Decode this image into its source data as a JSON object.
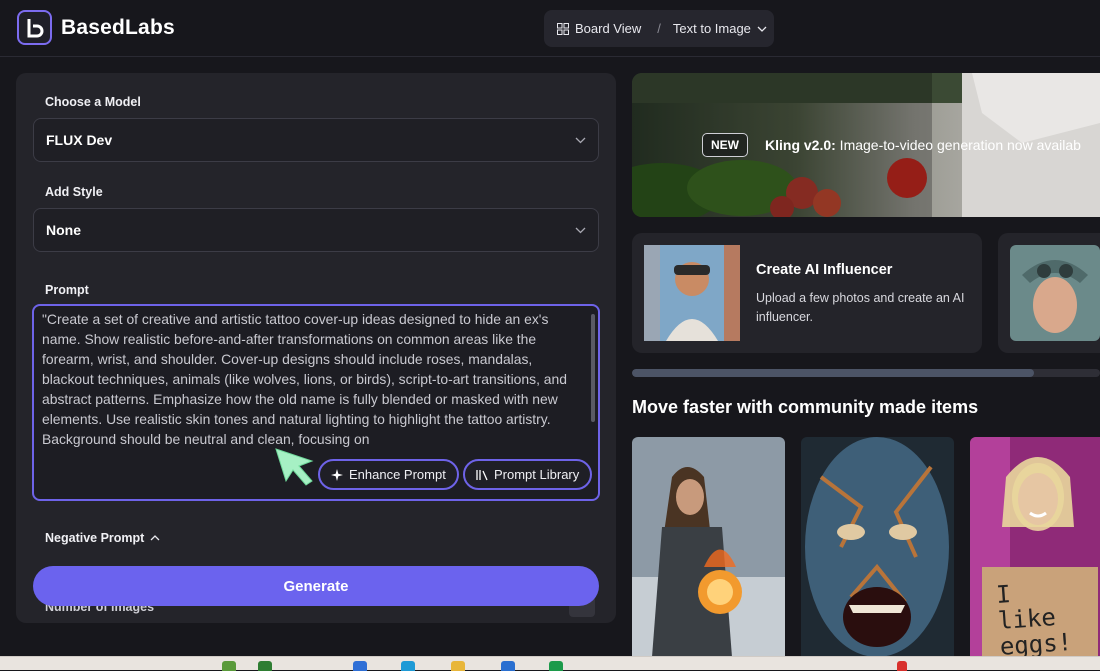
{
  "app": {
    "name": "BasedLabs"
  },
  "header": {
    "board_view": "Board View",
    "separator": "/",
    "mode": "Text to Image"
  },
  "form": {
    "model_label": "Choose a Model",
    "model_value": "FLUX Dev",
    "style_label": "Add Style",
    "style_value": "None",
    "prompt_label": "Prompt",
    "prompt_text": "\"Create a set of creative and artistic tattoo cover-up ideas designed to hide an ex's name. Show realistic before-and-after transformations on common areas like the forearm, wrist, and shoulder. Cover-up designs should include roses, mandalas, blackout techniques, animals (like wolves, lions, or birds), script-to-art transitions, and abstract patterns. Emphasize how the old name is fully blended or masked with new elements. Use realistic skin tones and natural lighting to highlight the tattoo artistry. Background should be neutral and clean, focusing on",
    "enhance_label": "Enhance Prompt",
    "library_label": "Prompt Library",
    "negative_label": "Negative Prompt",
    "generate_label": "Generate",
    "num_images_label": "Number of images"
  },
  "banner": {
    "badge": "NEW",
    "title": "Kling v2.0:",
    "text": " Image-to-video generation now availab"
  },
  "card": {
    "title": "Create AI Influencer",
    "description": "Upload a few photos and create an AI influencer."
  },
  "carousel": {
    "progress": 0.86
  },
  "community": {
    "title": "Move faster with community made items",
    "items": [
      {
        "name": "fire-orb-warrior"
      },
      {
        "name": "cracked-face-monster"
      },
      {
        "name": "i-like-eggs-sign",
        "sign_text": "I like eggs!"
      }
    ]
  },
  "colors": {
    "accent": "#6b63ee",
    "panel": "#24242a",
    "background": "#17171c"
  }
}
